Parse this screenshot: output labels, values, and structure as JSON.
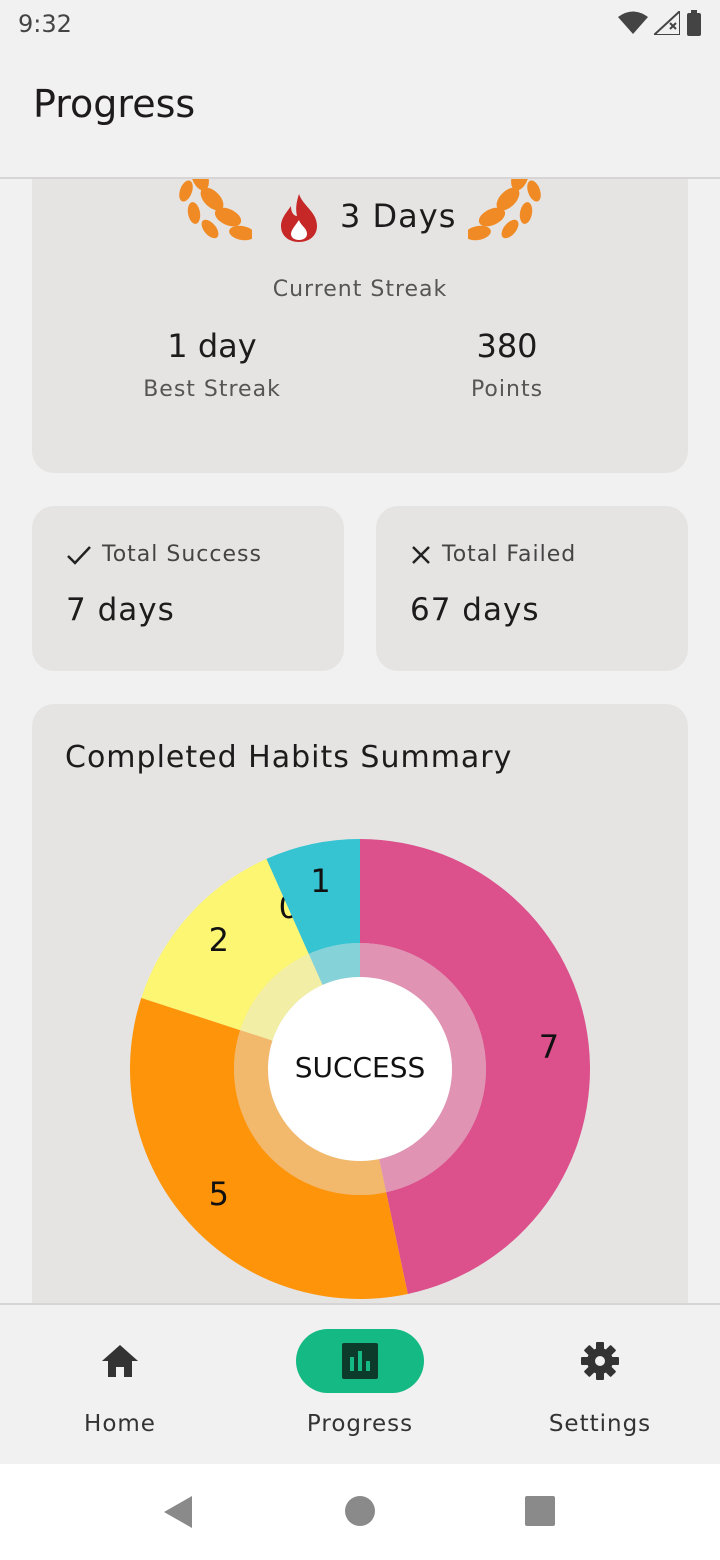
{
  "status_bar": {
    "time": "9:32"
  },
  "app_bar": {
    "title": "Progress"
  },
  "streak_card": {
    "current_streak_value": "3 Days",
    "current_streak_label": "Current Streak",
    "best_streak_value": "1 day",
    "best_streak_label": "Best Streak",
    "points_value": "380",
    "points_label": "Points"
  },
  "totals": {
    "success_label": "Total Success",
    "success_value": "7 days",
    "failed_label": "Total Failed",
    "failed_value": "67 days"
  },
  "summary": {
    "title": "Completed Habits Summary",
    "center_label": "SUCCESS"
  },
  "chart_data": {
    "type": "pie",
    "title": "Completed Habits Summary",
    "center_label": "SUCCESS",
    "slices": [
      {
        "value": 7,
        "color": "#dc508c"
      },
      {
        "value": 5,
        "color": "#fe9409"
      },
      {
        "value": 2,
        "color": "#fdf672"
      },
      {
        "value": 0,
        "color": "#7fc97f"
      },
      {
        "value": 1,
        "color": "#36c3d2"
      }
    ]
  },
  "bottom_nav": {
    "items": [
      {
        "label": "Home",
        "icon": "home-icon",
        "active": false
      },
      {
        "label": "Progress",
        "icon": "bar-chart-icon",
        "active": true
      },
      {
        "label": "Settings",
        "icon": "gear-icon",
        "active": false
      }
    ],
    "active_color": "#14b983"
  }
}
